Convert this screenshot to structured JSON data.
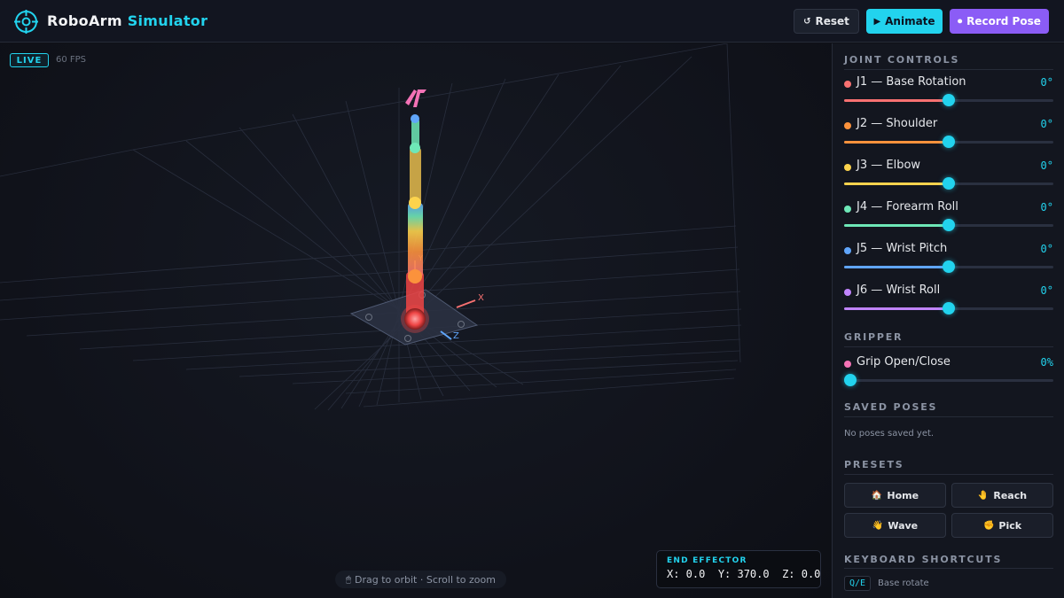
{
  "app": {
    "title_main": "RoboArm",
    "title_accent": "Simulator"
  },
  "toolbar": {
    "reset_label": "Reset",
    "reset_icon": "↺",
    "animate_label": "Animate",
    "animate_icon": "▶",
    "record_label": "Record Pose",
    "record_icon": "⏺"
  },
  "viewport": {
    "live_label": "LIVE",
    "fps_label": "60 FPS",
    "hint_icon": "🖱",
    "hint_text": "Drag to orbit · Scroll to zoom",
    "axis_x": "X",
    "axis_y": "Y",
    "axis_z": "Z"
  },
  "end_effector": {
    "title": "END EFFECTOR",
    "x": "X: 0.0",
    "y": "Y: 370.0",
    "z": "Z: 0.0"
  },
  "joint_controls": {
    "title": "JOINT CONTROLS",
    "joints": [
      {
        "label": "J1 — Base Rotation",
        "value": "0°",
        "level": 0.5,
        "color": "#f87171"
      },
      {
        "label": "J2 — Shoulder",
        "value": "0°",
        "level": 0.5,
        "color": "#fb923c"
      },
      {
        "label": "J3 — Elbow",
        "value": "0°",
        "level": 0.5,
        "color": "#fcd34d"
      },
      {
        "label": "J4 — Forearm Roll",
        "value": "0°",
        "level": 0.5,
        "color": "#6ee7b7"
      },
      {
        "label": "J5 — Wrist Pitch",
        "value": "0°",
        "level": 0.5,
        "color": "#60a5fa"
      },
      {
        "label": "J6 — Wrist Roll",
        "value": "0°",
        "level": 0.5,
        "color": "#c084fc"
      }
    ]
  },
  "gripper": {
    "title": "GRIPPER",
    "label": "Grip Open/Close",
    "value": "0%",
    "level": 0.0,
    "color": "#f472b6"
  },
  "saved_poses": {
    "title": "SAVED POSES",
    "empty_text": "No poses saved yet."
  },
  "presets": {
    "title": "PRESETS",
    "items": [
      {
        "label": "Home",
        "icon": "🏠"
      },
      {
        "label": "Reach",
        "icon": "🤚"
      },
      {
        "label": "Wave",
        "icon": "👋"
      },
      {
        "label": "Pick",
        "icon": "✊"
      }
    ]
  },
  "shortcuts": {
    "title": "KEYBOARD SHORTCUTS",
    "items": [
      {
        "key": "Q/E",
        "desc": "Base rotate"
      }
    ]
  },
  "colors": {
    "accent": "#22d3ee",
    "record": "#8b5cf6",
    "background": "#0f1117"
  }
}
